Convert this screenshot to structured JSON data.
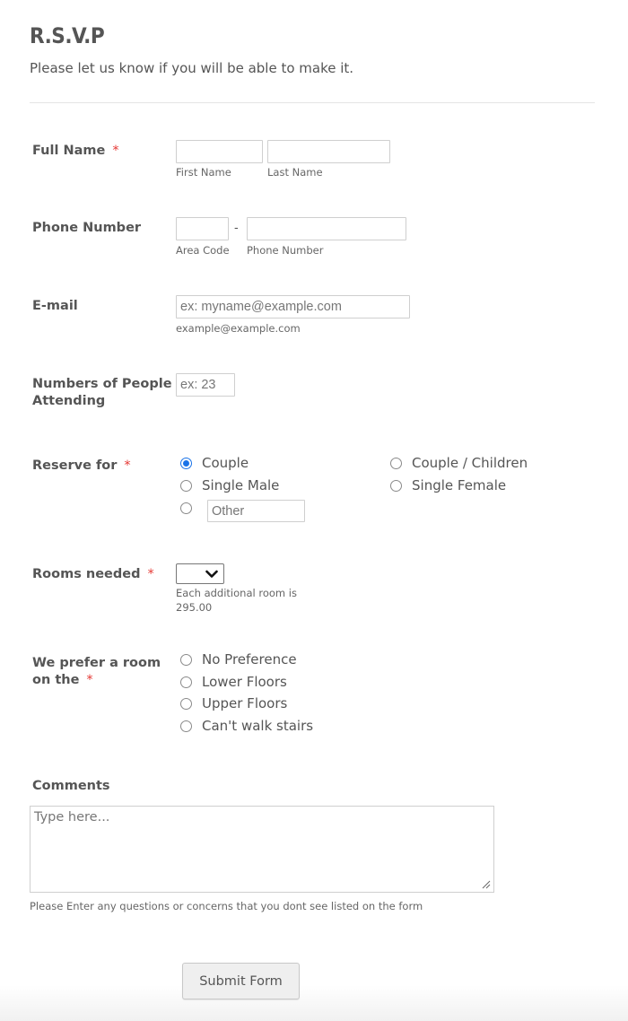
{
  "header": {
    "title": "R.S.V.P",
    "subtitle": "Please let us know if you will be able to make it."
  },
  "colors": {
    "required": "#e53935",
    "radio_checked": "#1a73e8",
    "text": "#555555"
  },
  "full_name": {
    "label": "Full Name",
    "required_mark": "*",
    "first_value": "",
    "last_value": "",
    "first_sublabel": "First Name",
    "last_sublabel": "Last Name"
  },
  "phone": {
    "label": "Phone Number",
    "separator": "-",
    "area_value": "",
    "number_value": "",
    "area_sublabel": "Area Code",
    "number_sublabel": "Phone Number"
  },
  "email": {
    "label": "E-mail",
    "placeholder": "ex: myname@example.com",
    "value": "",
    "sublabel": "example@example.com"
  },
  "attendees": {
    "label": "Numbers of People Attending",
    "placeholder": "ex: 23",
    "value": ""
  },
  "reserve_for": {
    "label": "Reserve for",
    "required_mark": "*",
    "options": [
      {
        "label": "Couple",
        "checked": true
      },
      {
        "label": "Single Male",
        "checked": false
      },
      {
        "label": "Couple / Children",
        "checked": false
      },
      {
        "label": "Single Female",
        "checked": false
      }
    ],
    "other_placeholder": "Other",
    "other_checked": false
  },
  "rooms": {
    "label": "Rooms needed",
    "required_mark": "*",
    "selected": "",
    "sublabel_line1": "Each additional room is",
    "sublabel_line2": "295.00"
  },
  "room_pref": {
    "label_line1": "We prefer a room",
    "label_line2": "on the",
    "required_mark": "*",
    "options": [
      {
        "label": "No Preference",
        "checked": false
      },
      {
        "label": "Lower Floors",
        "checked": false
      },
      {
        "label": "Upper Floors",
        "checked": false
      },
      {
        "label": "Can't walk stairs",
        "checked": false
      }
    ]
  },
  "comments": {
    "label": "Comments",
    "placeholder": "Type here...",
    "value": "",
    "sublabel": "Please Enter any questions or concerns that you dont see listed on the form"
  },
  "submit": {
    "label": "Submit Form"
  }
}
